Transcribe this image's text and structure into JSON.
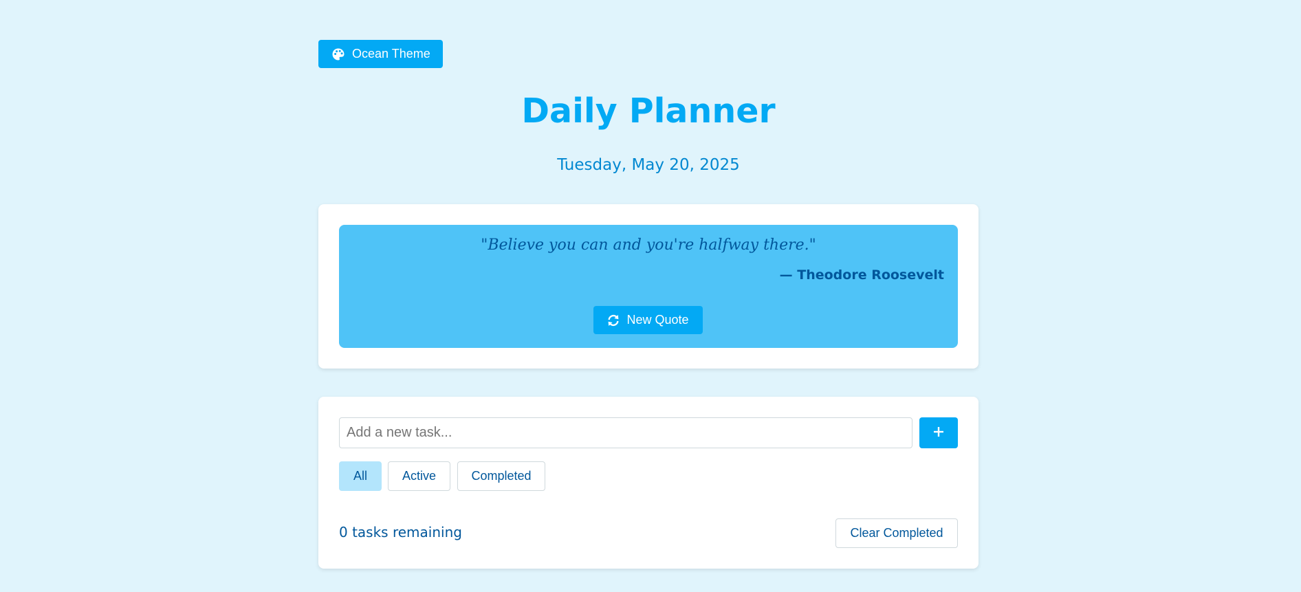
{
  "theme_button": {
    "label": "Ocean Theme",
    "icon": "palette-icon"
  },
  "header": {
    "title": "Daily Planner",
    "date": "Tuesday, May 20, 2025"
  },
  "quote": {
    "text": "\"Believe you can and you're halfway there.\"",
    "author": "— Theodore Roosevelt",
    "new_quote_label": "New Quote",
    "new_quote_icon": "refresh-icon"
  },
  "tasks": {
    "input_placeholder": "Add a new task...",
    "input_value": "",
    "add_label": "+",
    "filters": [
      {
        "label": "All",
        "selected": true
      },
      {
        "label": "Active",
        "selected": false
      },
      {
        "label": "Completed",
        "selected": false
      }
    ],
    "remaining_text": "0 tasks remaining",
    "clear_completed_label": "Clear Completed",
    "items": []
  },
  "colors": {
    "background": "#e0f4fc",
    "accent": "#03a9f4",
    "quote_background": "#4fc3f7",
    "dark_text": "#01579b",
    "selected_filter": "#b3e5fc"
  }
}
